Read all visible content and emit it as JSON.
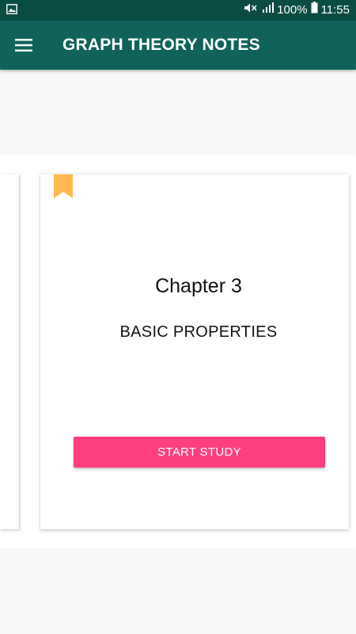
{
  "status_bar": {
    "battery": "100%",
    "time": "11:55",
    "icons": [
      "image-icon",
      "mute-icon",
      "signal-icon",
      "battery-icon"
    ]
  },
  "app_bar": {
    "title": "GRAPH THEORY NOTES",
    "menu_icon": "hamburger-menu-icon"
  },
  "card": {
    "chapter": "Chapter 3",
    "subtitle": "BASIC PROPERTIES",
    "button_label": "START STUDY",
    "bookmark_icon": "bookmark-icon"
  },
  "colors": {
    "status_bar": "#0a4c44",
    "app_bar": "#10625a",
    "accent": "#fd3f7f",
    "bookmark": "#ffb94f",
    "background": "#f7f7f7"
  }
}
